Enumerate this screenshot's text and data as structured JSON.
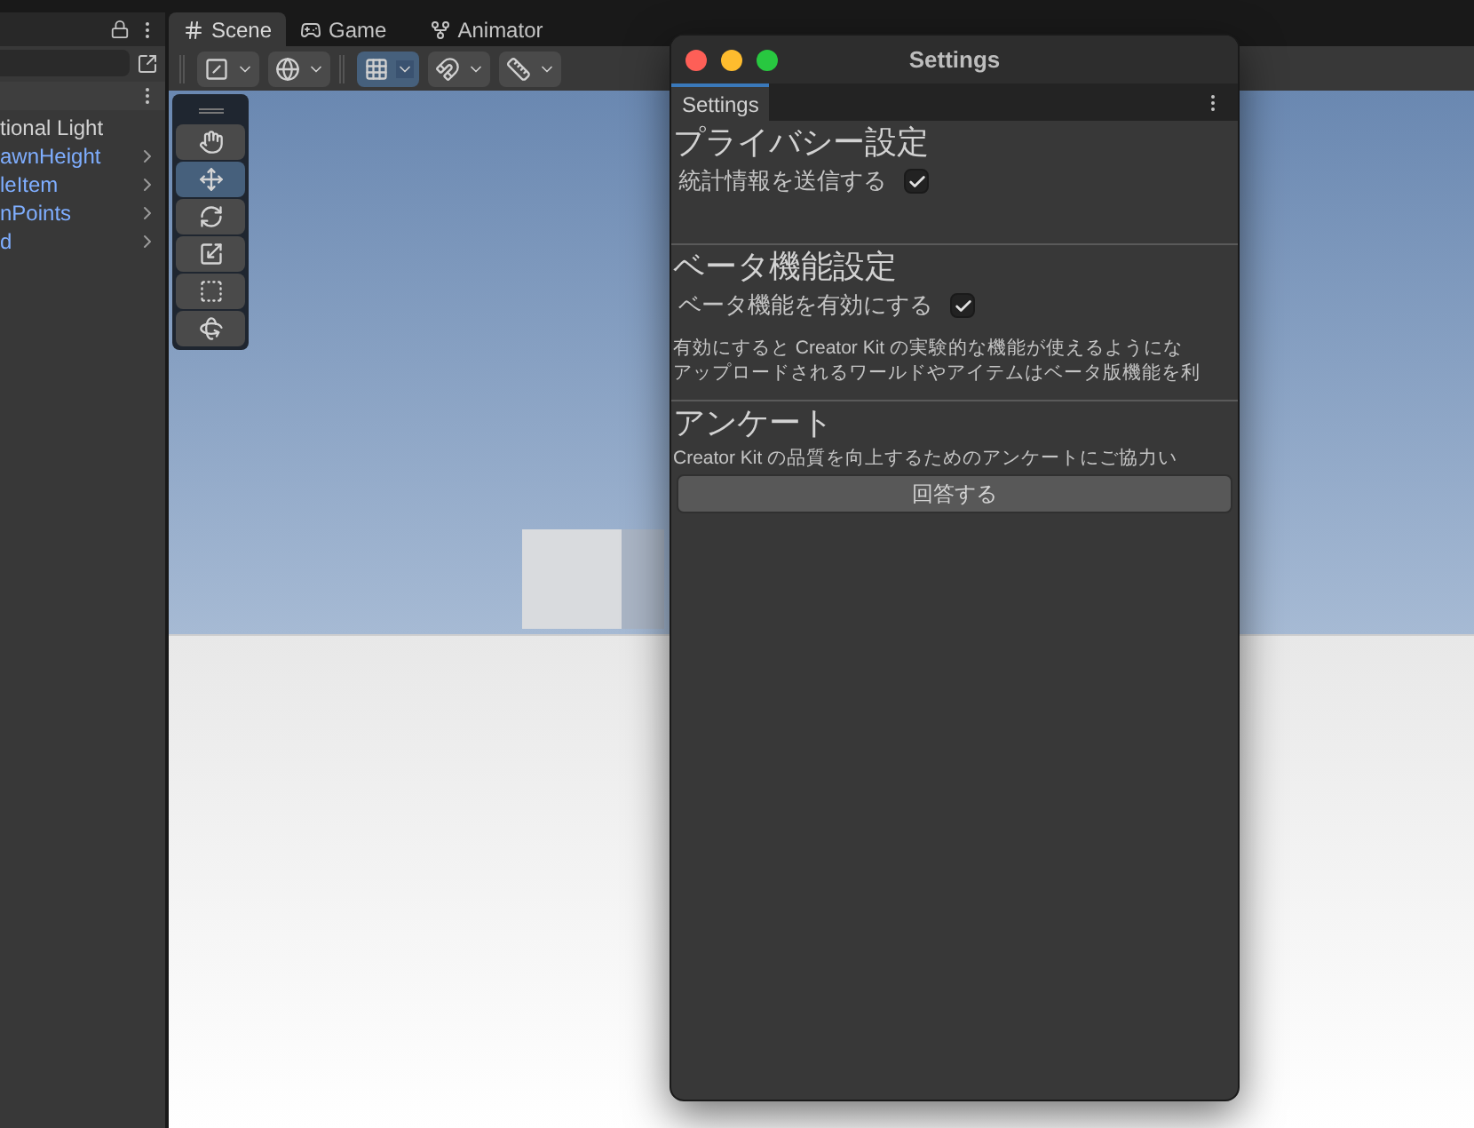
{
  "hierarchy": {
    "items": [
      {
        "label": "tional Light",
        "kind": "object"
      },
      {
        "label": "awnHeight",
        "kind": "prefab"
      },
      {
        "label": "leItem",
        "kind": "prefab"
      },
      {
        "label": "nPoints",
        "kind": "prefab"
      },
      {
        "label": "d",
        "kind": "prefab"
      }
    ]
  },
  "scene_tabs": [
    {
      "label": "Scene",
      "kind": "scene",
      "selected": true
    },
    {
      "label": "Game",
      "kind": "game",
      "selected": false
    },
    {
      "label": "Animator",
      "kind": "animator",
      "selected": false
    }
  ],
  "scene_toolbar": [
    {
      "kind": "draw-mode",
      "selected": false
    },
    {
      "kind": "globe",
      "selected": false
    },
    {
      "kind": "grid",
      "selected": true
    },
    {
      "kind": "snap",
      "selected": false
    },
    {
      "kind": "ruler",
      "selected": false
    }
  ],
  "tools": [
    {
      "kind": "hand",
      "selected": false
    },
    {
      "kind": "move",
      "selected": true
    },
    {
      "kind": "rotate",
      "selected": false
    },
    {
      "kind": "scale",
      "selected": false
    },
    {
      "kind": "rect",
      "selected": false
    },
    {
      "kind": "transform",
      "selected": false
    }
  ],
  "settings_window": {
    "title": "Settings",
    "tab": "Settings",
    "sections": [
      {
        "heading": "プライバシー設定",
        "toggles": [
          {
            "label": "統計情報を送信する",
            "checked": true
          }
        ]
      },
      {
        "heading": "ベータ機能設定",
        "toggles": [
          {
            "label": "ベータ機能を有効にする",
            "checked": true
          }
        ],
        "description": [
          "有効にすると Creator Kit の実験的な機能が使えるようにな",
          "アップロードされるワールドやアイテムはベータ版機能を利"
        ]
      },
      {
        "heading": "アンケート",
        "description": [
          "Creator Kit の品質を向上するためのアンケートにご協力い"
        ],
        "button": "回答する"
      }
    ]
  }
}
